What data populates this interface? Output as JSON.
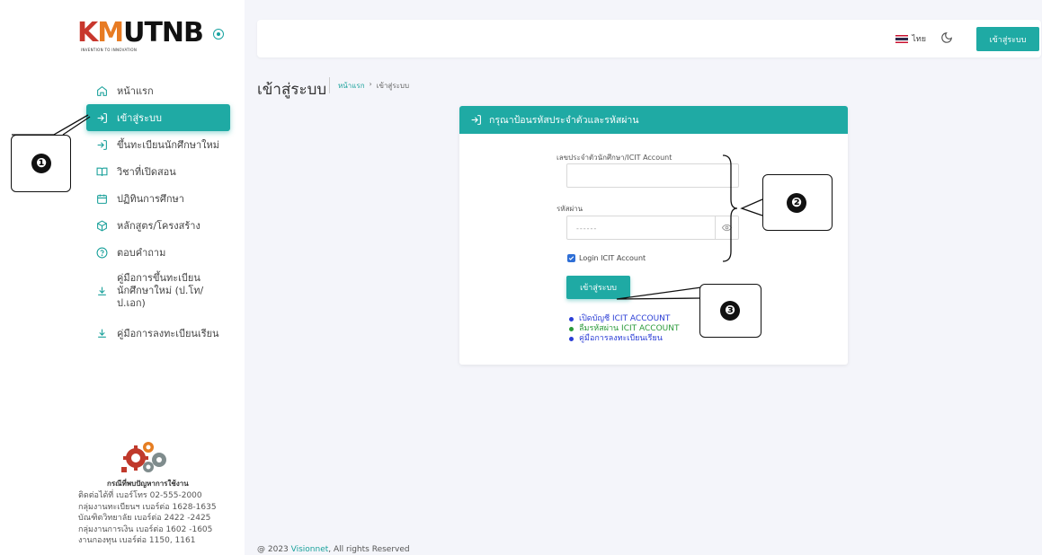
{
  "logo": {
    "text_k": "K",
    "text_m": "M",
    "text_rest": "UTNB",
    "tagline": "INVENTION TO INNOVATION"
  },
  "sidebar": {
    "items": [
      {
        "label": "หน้าแรก",
        "icon": "home-icon"
      },
      {
        "label": "เข้าสู่ระบบ",
        "icon": "login-icon",
        "active": true
      },
      {
        "label": "ขึ้นทะเบียนนักศึกษาใหม่",
        "icon": "login-icon"
      },
      {
        "label": "วิชาที่เปิดสอน",
        "icon": "book-icon"
      },
      {
        "label": "ปฏิทินการศึกษา",
        "icon": "calendar-icon"
      },
      {
        "label": "หลักสูตร/โครงสร้าง",
        "icon": "box-icon"
      },
      {
        "label": "ตอบคำถาม",
        "icon": "help-circle-icon"
      },
      {
        "label_lines": [
          "คู่มือการขึ้นทะเบียน",
          "นักศึกษาใหม่ (ป.โท/",
          "ป.เอก)"
        ],
        "icon": "download-icon"
      },
      {
        "label": "คู่มือการลงทะเบียนเรียน",
        "icon": "download-icon"
      }
    ],
    "help": {
      "title": "กรณีที่พบปัญหาการใช้งาน",
      "lines": [
        "ติดต่อได้ที่ เบอร์โทร 02-555-2000",
        "กลุ่มงานทะเบียนฯ เบอร์ต่อ 1628-1635",
        "บัณฑิตวิทยาลัย เบอร์ต่อ 2422 -2425",
        "กลุ่มงานการเงิน เบอร์ต่อ 1602 -1605",
        "งานกองทุน เบอร์ต่อ 1150, 1161"
      ]
    }
  },
  "topbar": {
    "language": "ไทย",
    "login_label": "เข้าสู่ระบบ"
  },
  "page": {
    "title": "เข้าสู่ระบบ",
    "breadcrumb_home": "หน้าแรก",
    "breadcrumb_sep": "›",
    "breadcrumb_current": "เข้าสู่ระบบ"
  },
  "login_card": {
    "header": "กรุณาป้อนรหัสประจำตัวและรหัสผ่าน",
    "username_label": "เลขประจำตัวนักศึกษา/ICIT Account",
    "username_value": "",
    "password_label": "รหัสผ่าน",
    "password_placeholder": "------",
    "checkbox_label": "Login ICIT Account",
    "checkbox_checked": true,
    "submit_label": "เข้าสู่ระบบ",
    "links": [
      "เปิดบัญชี ICIT ACCOUNT",
      "ลืมรหัสผ่าน ICIT ACCOUNT",
      "คู่มือการลงทะเบียนเรียน"
    ]
  },
  "annotations": [
    "❶",
    "❷",
    "❸"
  ],
  "footer": {
    "prefix": "@ 2023 ",
    "brand": "Visionnet",
    "suffix": ", All rights Reserved"
  },
  "colors": {
    "accent": "#1faaa4",
    "link_blue": "#2b3ed6",
    "link_green": "#2a9a3a"
  }
}
